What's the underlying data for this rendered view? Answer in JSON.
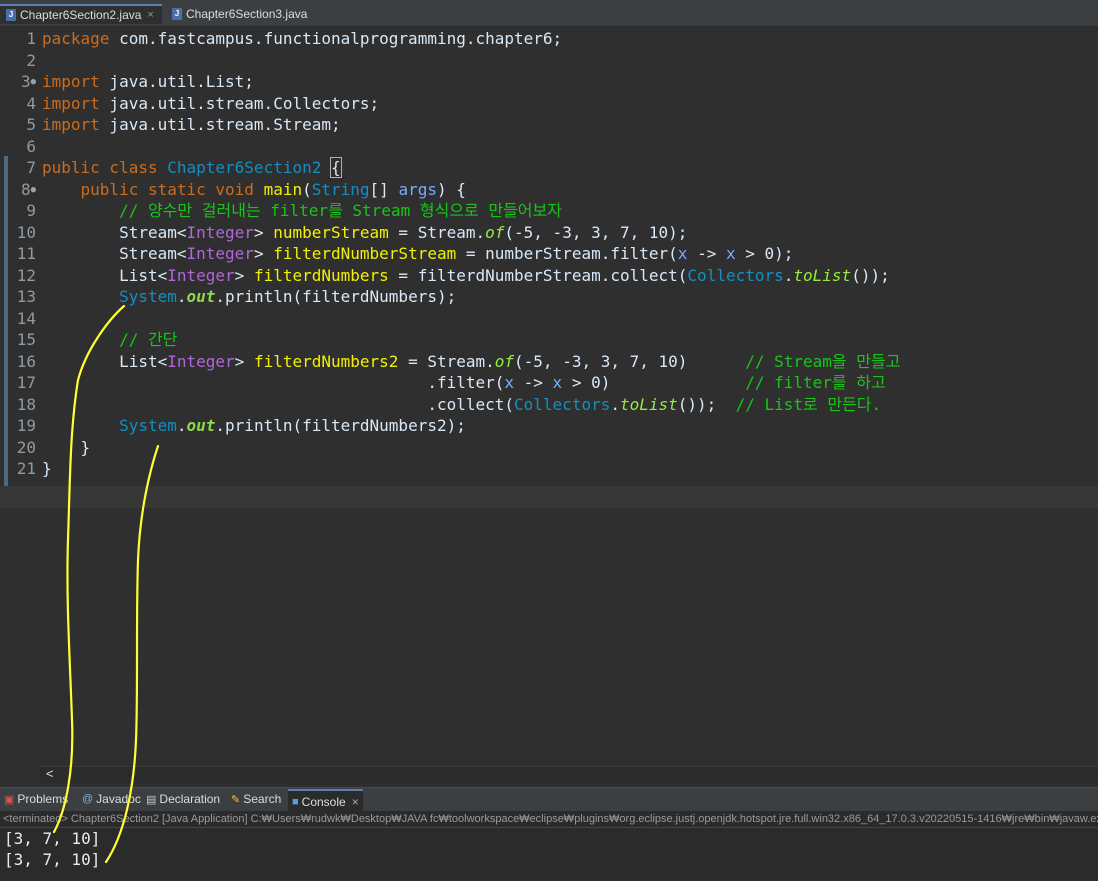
{
  "tabs": [
    {
      "label": "Chapter6Section2.java",
      "close": "×"
    },
    {
      "label": "Chapter6Section3.java"
    }
  ],
  "code": {
    "l1": {
      "n": "1",
      "kw": "package",
      "rest": " com.fastcampus.functionalprogramming.chapter6;"
    },
    "l2": {
      "n": "2"
    },
    "l3": {
      "n": "3",
      "kw": "import",
      "rest": " java.util.List;"
    },
    "l4": {
      "n": "4",
      "kw": "import",
      "rest": " java.util.stream.Collectors;"
    },
    "l5": {
      "n": "5",
      "kw": "import",
      "rest": " java.util.stream.Stream;"
    },
    "l6": {
      "n": "6"
    },
    "l7": {
      "n": "7",
      "kw": "public class",
      "name": "Chapter6Section2",
      "brace": "{"
    },
    "l8": {
      "n": "8",
      "kw": "public static void",
      "m": "main",
      "p1": "(",
      "t": "String",
      "p2": "[] ",
      "arg": "args",
      "p3": ") {"
    },
    "l9": {
      "n": "9",
      "comment": "// 양수만 걸러내는 filter를 Stream 형식으로 만들어보자"
    },
    "l10": {
      "n": "10",
      "a": "Stream<",
      "g": "Integer",
      "b": "> ",
      "v": "numberStream",
      "c": " = Stream.",
      "of": "of",
      "d": "(-5, -3, 3, 7, 10);"
    },
    "l11": {
      "n": "11",
      "a": "Stream<",
      "g": "Integer",
      "b": "> ",
      "v": "filterdNumberStream",
      "c": " = numberStream.filter(",
      "x": "x",
      "arrow": " -> ",
      "x2": "x",
      "d": " > 0);"
    },
    "l12": {
      "n": "12",
      "a": "List<",
      "g": "Integer",
      "b": "> ",
      "v": "filterdNumbers",
      "c": " = filterdNumberStream.collect(",
      "col": "Collectors",
      "dot": ".",
      "tl": "toList",
      "d": "());"
    },
    "l13": {
      "n": "13",
      "sys": "System",
      "dot": ".",
      "out": "out",
      "rest": ".println(filterdNumbers);"
    },
    "l14": {
      "n": "14"
    },
    "l15": {
      "n": "15",
      "comment": "// 간단"
    },
    "l16": {
      "n": "16",
      "a": "List<",
      "g": "Integer",
      "b": "> ",
      "v": "filterdNumbers2",
      "c": " = Stream.",
      "of": "of",
      "d": "(-5, -3, 3, 7, 10)      ",
      "comment": "// Stream을 만들고"
    },
    "l17": {
      "n": "17",
      "c": "                                .filter(",
      "x": "x",
      "arrow": " -> ",
      "x2": "x",
      "d": " > 0)              ",
      "comment": "// filter를 하고"
    },
    "l18": {
      "n": "18",
      "c": "                                .collect(",
      "col": "Collectors",
      "dot": ".",
      "tl": "toList",
      "d": "());  ",
      "comment": "// List로 만든다."
    },
    "l19": {
      "n": "19",
      "sys": "System",
      "dot": ".",
      "out": "out",
      "rest": ".println(filterdNumbers2);"
    },
    "l20": {
      "n": "20",
      "rest": "    }"
    },
    "l21": {
      "n": "21",
      "rest": "}"
    }
  },
  "scroll_left": "<",
  "panel_tabs": {
    "problems": "Problems",
    "javadoc": "Javadoc",
    "declaration": "Declaration",
    "search": "Search",
    "console": "Console",
    "close": "×"
  },
  "status_text": "<terminated> Chapter6Section2 [Java Application] C:₩Users₩rudwk₩Desktop₩JAVA fc₩toolworkspace₩eclipse₩plugins₩org.eclipse.justj.openjdk.hotspot.jre.full.win32.x86_64_17.0.3.v20220515-1416₩jre₩bin₩javaw.exe",
  "console_output": [
    "[3, 7, 10]",
    "[3, 7, 10]"
  ],
  "colors": {
    "annotation": "#ffff33",
    "keyword": "#cc6c1d",
    "type": "#1290c3",
    "comment": "#17c617"
  }
}
